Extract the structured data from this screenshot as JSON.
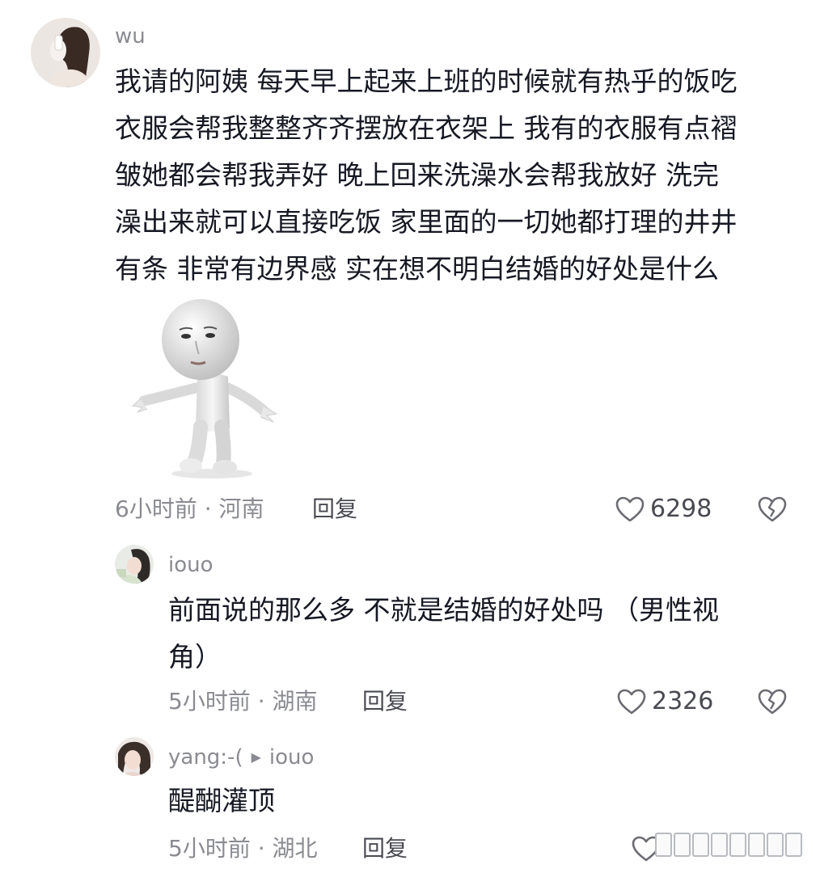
{
  "comments": [
    {
      "username": "wu",
      "text_lines": [
        "我请的阿姨 每天早上起来上班的时候就有热乎的饭吃",
        "衣服会帮我整整齐齐摆放在衣架上 我有的衣服有点褶",
        "皱她都会帮我弄好 晚上回来洗澡水会帮我放好 洗完",
        "澡出来就可以直接吃饭 家里面的一切她都打理的井井",
        "有条 非常有边界感 实在想不明白结婚的好处是什么"
      ],
      "meta": "6小时前 · 河南",
      "reply_label": "回复",
      "likes": "6298"
    },
    {
      "username": "iouo",
      "text_lines": [
        "前面说的那么多 不就是结婚的好处吗 （男性视",
        "角）"
      ],
      "meta": "5小时前 · 湖南",
      "reply_label": "回复",
      "likes": "2326"
    },
    {
      "username": "yang:-(",
      "reply_to": "iouo",
      "reply_arrow": "▶",
      "text_lines": [
        "醍醐灌顶"
      ],
      "meta": "5小时前 · 湖北",
      "reply_label": "回复",
      "likes": ""
    }
  ],
  "sticker": {
    "description_icon": "shrugging-3d-figure-sticker"
  },
  "colors": {
    "text_primary": "#161823",
    "text_secondary": "#8a8b91",
    "icon_gray": "#6b6c72"
  }
}
